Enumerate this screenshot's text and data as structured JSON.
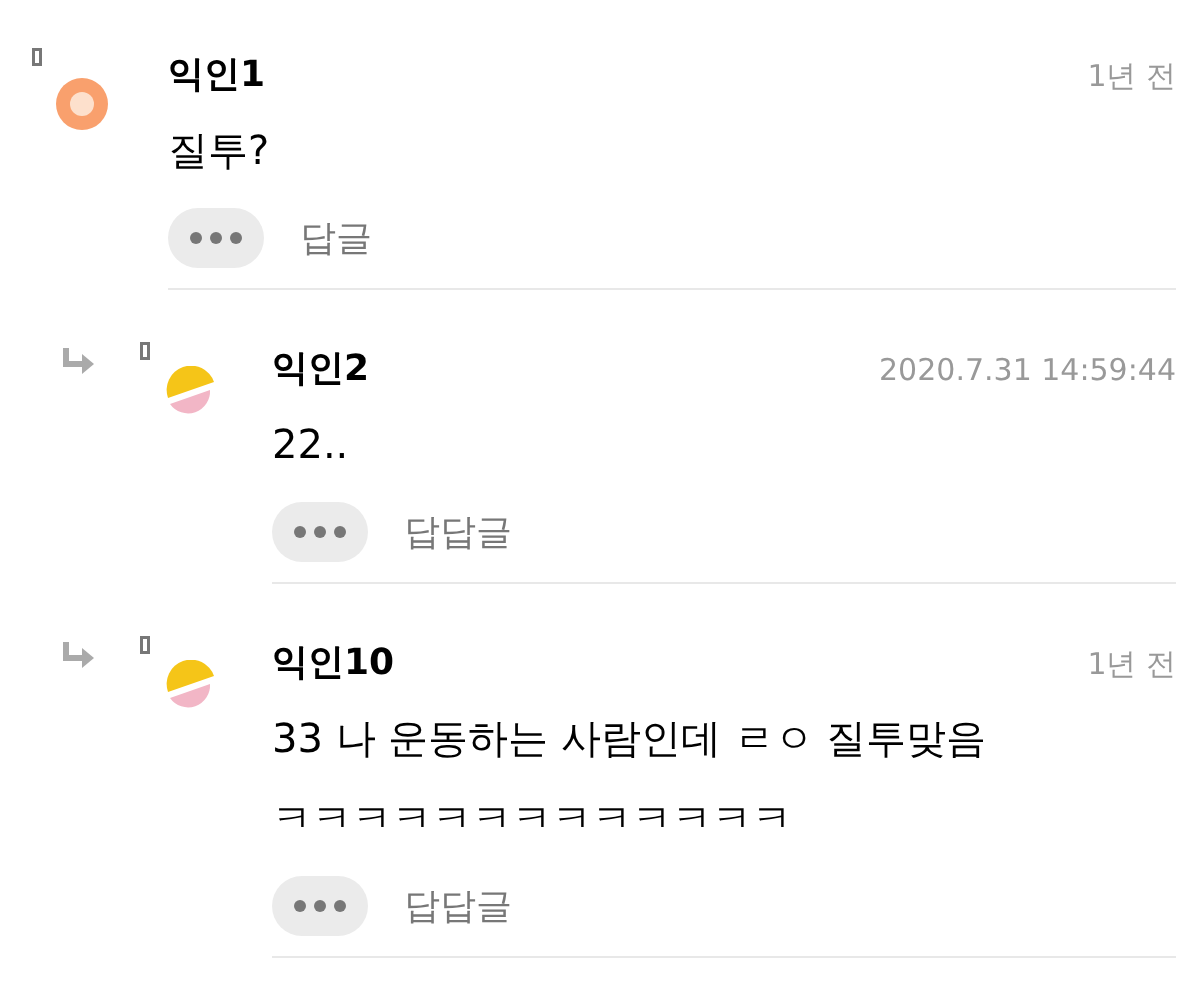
{
  "comments": [
    {
      "kind": "comment",
      "avatar": {
        "kind": "ring"
      },
      "author": "익인1",
      "time": "1년 전",
      "body": [
        "질투?"
      ],
      "reply_label": "답글"
    },
    {
      "kind": "reply",
      "avatar": {
        "kind": "split"
      },
      "author": "익인2",
      "time": "2020.7.31 14:59:44",
      "body": [
        "22.."
      ],
      "reply_label": "답답글"
    },
    {
      "kind": "reply",
      "avatar": {
        "kind": "split"
      },
      "author": "익인10",
      "time": "1년 전",
      "body": [
        "33 나 운동하는 사람인데 ㄹㅇ 질투맞음",
        "ㅋㅋㅋㅋㅋㅋㅋㅋㅋㅋㅋㅋㅋ"
      ],
      "reply_label": "답답글"
    }
  ]
}
